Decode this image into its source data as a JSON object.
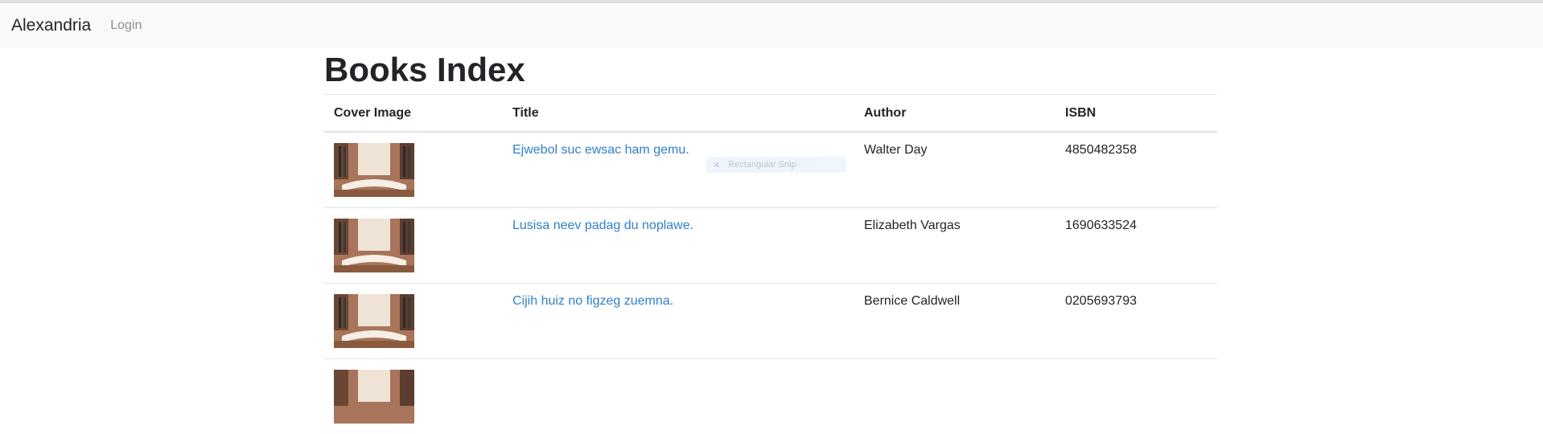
{
  "navbar": {
    "brand": "Alexandria",
    "login": "Login"
  },
  "page": {
    "title": "Books Index"
  },
  "table": {
    "headers": [
      "Cover Image",
      "Title",
      "Author",
      "ISBN"
    ],
    "rows": [
      {
        "title": "Ejwebol suc ewsac ham gemu.",
        "author": "Walter Day",
        "isbn": "4850482358"
      },
      {
        "title": "Lusisa neev padag du noplawe.",
        "author": "Elizabeth Vargas",
        "isbn": "1690633524"
      },
      {
        "title": "Cijih huiz no figzeg zuemna.",
        "author": "Bernice Caldwell",
        "isbn": "0205693793"
      },
      {
        "title": "",
        "author": "",
        "isbn": ""
      }
    ]
  },
  "overlay": {
    "label": "Rectangular Snip",
    "icon": "close-icon"
  },
  "colors": {
    "link": "#2f80c9",
    "navbar_bg": "#f8f9fa"
  }
}
